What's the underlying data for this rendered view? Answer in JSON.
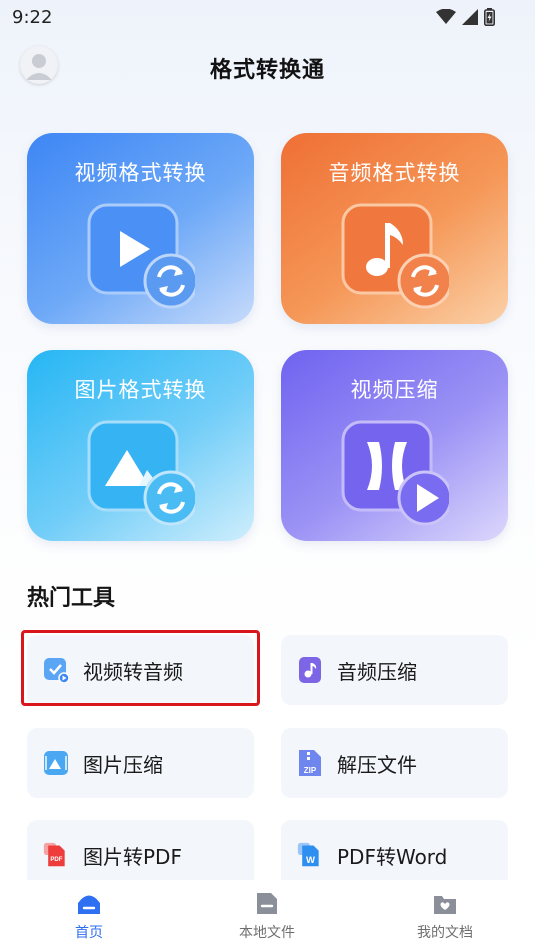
{
  "status_bar": {
    "time": "9:22",
    "icons": [
      "wifi-icon",
      "signal-icon",
      "battery-icon"
    ]
  },
  "header": {
    "title": "格式转换通",
    "avatar_icon": "avatar"
  },
  "feature_cards": [
    {
      "label": "视频格式转换",
      "icon": "video-play-icon",
      "color": "#3d86f5"
    },
    {
      "label": "音频格式转换",
      "icon": "music-note-icon",
      "color": "#ef6f35"
    },
    {
      "label": "图片格式转换",
      "icon": "image-icon",
      "color": "#26b6f4"
    },
    {
      "label": "视频压缩",
      "icon": "compress-icon",
      "color": "#6f62f0"
    }
  ],
  "section": {
    "title": "热门工具"
  },
  "tools": [
    {
      "label": "视频转音频",
      "icon": "video-to-audio-icon",
      "highlighted": true
    },
    {
      "label": "音频压缩",
      "icon": "audio-compress-icon"
    },
    {
      "label": "图片压缩",
      "icon": "image-compress-icon"
    },
    {
      "label": "解压文件",
      "icon": "zip-file-icon"
    },
    {
      "label": "图片转PDF",
      "icon": "image-to-pdf-icon"
    },
    {
      "label": "PDF转Word",
      "icon": "pdf-to-word-icon"
    }
  ],
  "icon_text": {
    "zip": "ZIP",
    "pdf": "PDF",
    "word": "W"
  },
  "bottom_nav": [
    {
      "label": "首页",
      "icon": "home-icon",
      "active": true
    },
    {
      "label": "本地文件",
      "icon": "local-file-icon",
      "active": false
    },
    {
      "label": "我的文档",
      "icon": "my-docs-icon",
      "active": false
    }
  ],
  "colors": {
    "accent": "#2f6ff1",
    "highlight_border": "#d9161b"
  }
}
